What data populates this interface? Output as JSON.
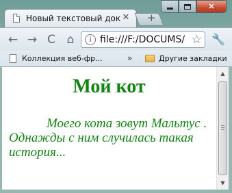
{
  "browser": {
    "tab_title": "Новый текстовый доку…",
    "tab_close_glyph": "✕",
    "new_tab_glyph": "+",
    "url": "file:///F:/DOCUMS/",
    "back_glyph": "←",
    "forward_glyph": "→",
    "reload_glyph": "C",
    "home_glyph": "⌂",
    "star_glyph": "☆",
    "wrench_glyph": "🔧",
    "window_close_glyph": "✕"
  },
  "bookmarks": {
    "collection_label": "Коллекция веб-фр...",
    "other_label": "Другие закладки",
    "chevron_glyph": "»"
  },
  "page": {
    "heading": "Мой кот",
    "story": "Моего кота зовут Мальтус . Однажды с ним случилась такая история...",
    "text_color": "#138413"
  },
  "scrollbar": {
    "up_glyph": "▲",
    "down_glyph": "▼"
  }
}
